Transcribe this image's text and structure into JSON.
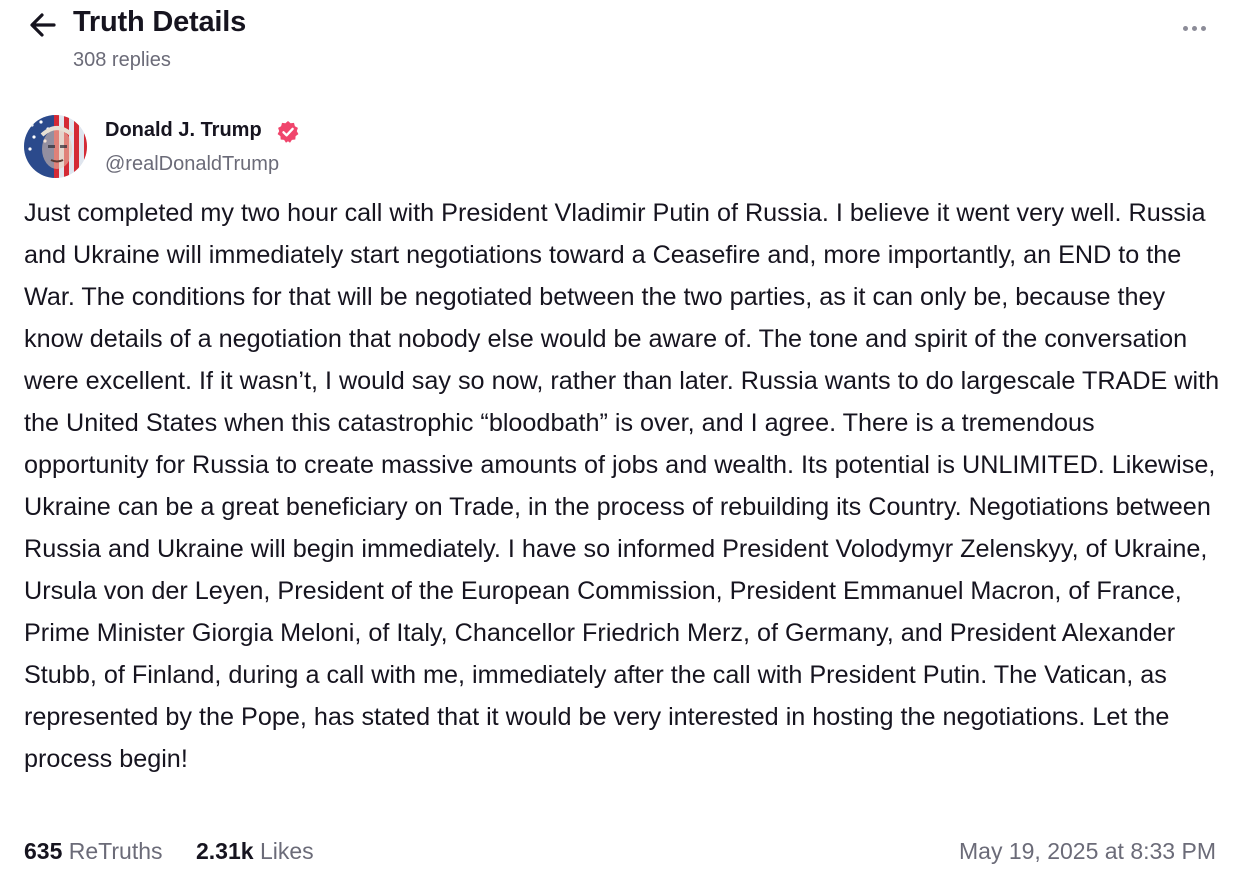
{
  "header": {
    "back_icon": "arrow-left-icon",
    "title": "Truth Details",
    "replies": "308 replies",
    "more_icon": "ellipsis-horizontal-icon"
  },
  "author": {
    "display_name": "Donald J. Trump",
    "handle": "@realDonaldTrump",
    "verified_icon": "verified-badge-icon",
    "verified_color": "#f0456c"
  },
  "post": {
    "text": "Just completed my two hour call with President Vladimir Putin of Russia. I believe it went very well. Russia and Ukraine will immediately start negotiations toward a Ceasefire and, more importantly, an END to the War. The conditions for that will be negotiated between the two parties, as it can only be, because they know details of a negotiation that nobody else would be aware of. The tone and spirit of the conversation were excellent. If it wasn’t, I would say so now, rather than later. Russia wants to do largescale TRADE with the United States when this catastrophic “bloodbath” is over, and I agree. There is a tremendous opportunity for Russia to create massive amounts of jobs and wealth. Its potential is UNLIMITED. Likewise, Ukraine can be a great beneficiary on Trade, in the process of rebuilding its Country. Negotiations between Russia and Ukraine will begin immediately. I have so informed President Volodymyr Zelenskyy, of Ukraine, Ursula von der Leyen, President of the European Commission, President Emmanuel Macron, of France, Prime Minister Giorgia Meloni, of Italy, Chancellor Friedrich Merz, of Germany, and President Alexander Stubb, of Finland, during a call with me, immediately after the call with President Putin. The Vatican, as represented by the Pope, has stated that it would be very interested in hosting the negotiations. Let the process begin!"
  },
  "stats": {
    "retruths_count": "635",
    "retruths_label": "ReTruths",
    "likes_count": "2.31k",
    "likes_label": "Likes",
    "timestamp": "May 19, 2025 at 8:33 PM"
  },
  "colors": {
    "text_primary": "#16141f",
    "text_secondary": "#6b6b78",
    "background": "#ffffff"
  }
}
